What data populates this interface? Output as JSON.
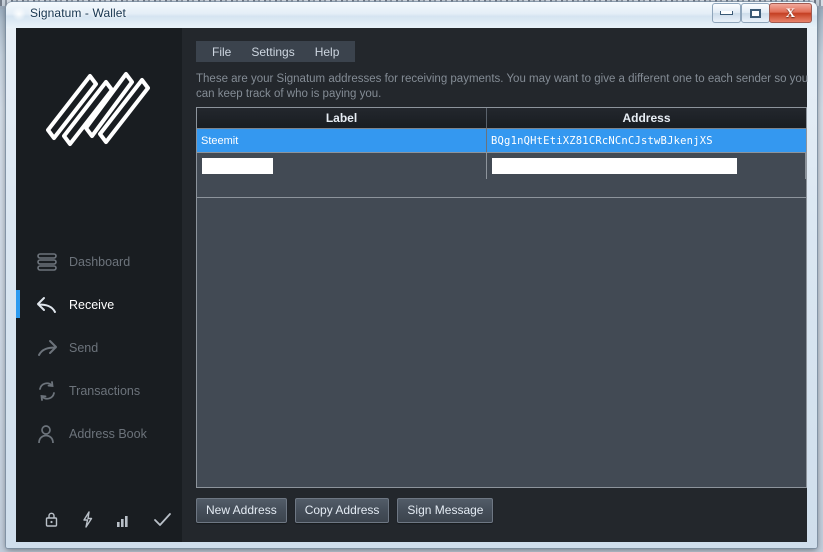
{
  "window": {
    "title": "Signatum - Wallet",
    "minimize_label": "Minimize",
    "maximize_label": "Maximize",
    "close_label": "X"
  },
  "menubar": {
    "items": [
      {
        "label": "File",
        "name": "menu-file"
      },
      {
        "label": "Settings",
        "name": "menu-settings"
      },
      {
        "label": "Help",
        "name": "menu-help"
      }
    ]
  },
  "sidebar": {
    "logo_name": "signatum-logo",
    "items": [
      {
        "label": "Dashboard",
        "icon": "dashboard-icon",
        "active": false
      },
      {
        "label": "Receive",
        "icon": "receive-arrow-icon",
        "active": true
      },
      {
        "label": "Send",
        "icon": "send-arrow-icon",
        "active": false
      },
      {
        "label": "Transactions",
        "icon": "transactions-refresh-icon",
        "active": false
      },
      {
        "label": "Address Book",
        "icon": "address-book-person-icon",
        "active": false
      }
    ],
    "status_icons": [
      {
        "name": "lock-icon",
        "label": "lock"
      },
      {
        "name": "lightning-icon",
        "label": "staking"
      },
      {
        "name": "signal-bars-icon",
        "label": "connections"
      },
      {
        "name": "checkmark-icon",
        "label": "synced"
      }
    ]
  },
  "main": {
    "description": "These are your Signatum addresses for receiving payments. You may want to give a different one to each sender so you can keep track of who is paying you.",
    "table": {
      "columns": [
        "Label",
        "Address"
      ],
      "rows": [
        {
          "label": "Steemit",
          "address": "BQg1nQHtEtiXZ81CRcNCnCJstwBJkenjXS",
          "selected": true
        }
      ],
      "edit_row": {
        "label_value": "",
        "address_value": ""
      }
    },
    "buttons": [
      {
        "label": "New Address",
        "name": "new-address-button"
      },
      {
        "label": "Copy Address",
        "name": "copy-address-button"
      },
      {
        "label": "Sign Message",
        "name": "sign-message-button"
      }
    ]
  },
  "colors": {
    "accent": "#3498f0",
    "sidebar_bg": "#191d21",
    "panel_bg": "#23272c",
    "table_bg": "#424a54",
    "header_bg": "#1c2026"
  }
}
